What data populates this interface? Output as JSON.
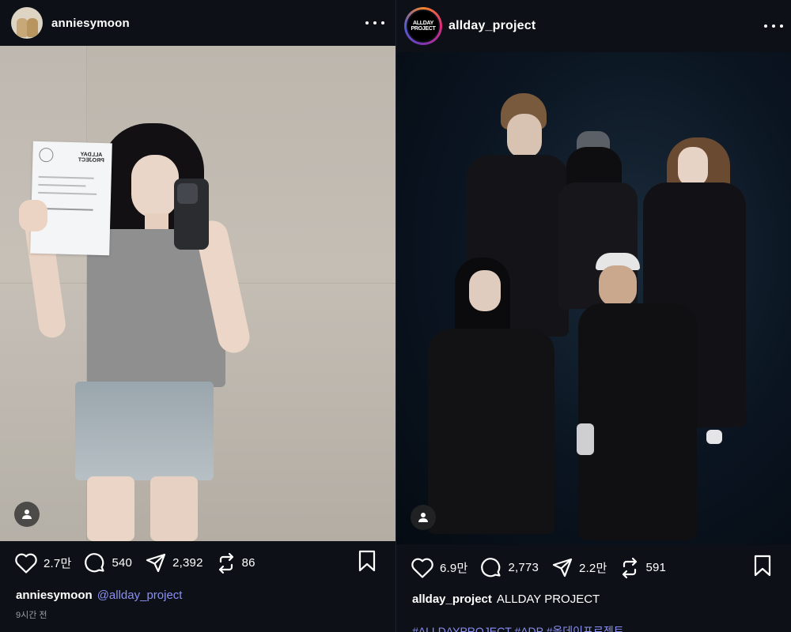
{
  "posts": [
    {
      "username": "anniesymoon",
      "caption_username": "anniesymoon",
      "caption_text": "@allday_project",
      "time": "9시간 전",
      "likes": "2.7만",
      "comments": "540",
      "shares": "2,392",
      "reposts": "86",
      "photo": {
        "paper_logo": "ALLDAY PROJECT"
      }
    },
    {
      "username": "allday_project",
      "avatar_logo": "ALLDAY PROJECT",
      "caption_username": "allday_project",
      "caption_text": "ALLDAY PROJECT",
      "hashtags": "#ALLDAYPROJECT #ADP #올데이프로젝트",
      "likes": "6.9만",
      "comments": "2,773",
      "shares": "2.2만",
      "reposts": "591"
    }
  ],
  "colors": {
    "background": "#0d1117",
    "mention": "#8b8ff2",
    "muted": "#9aa0a6"
  },
  "icons": [
    "more-icon",
    "heart-icon",
    "comment-icon",
    "share-icon",
    "repost-icon",
    "bookmark-icon",
    "user-tag-icon"
  ]
}
